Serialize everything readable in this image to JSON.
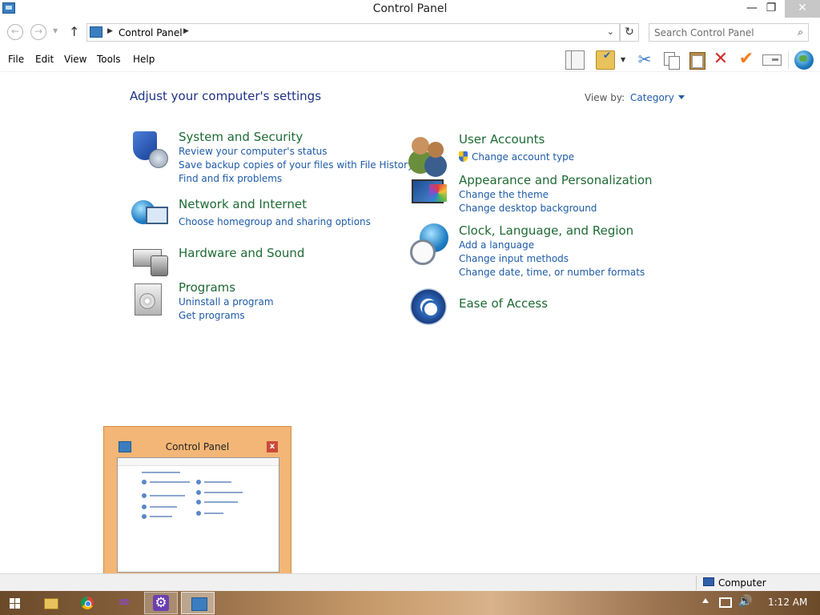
{
  "window": {
    "title": "Control Panel",
    "minimize": "—",
    "maximize": "❐",
    "close": "✕"
  },
  "address": {
    "breadcrumb": "Control Panel",
    "sep": "▶",
    "dropdown": "⌄",
    "refresh": "↻",
    "search_placeholder": "Search Control Panel",
    "search_icon": "⌕"
  },
  "nav": {
    "back": "←",
    "forward": "→",
    "recent": "▼",
    "up": "↑"
  },
  "menu": {
    "items": [
      "File",
      "Edit",
      "View",
      "Tools",
      "Help"
    ]
  },
  "toolbar": {
    "cut": "✂",
    "delete": "✕",
    "check": "✔",
    "drop": "▼"
  },
  "main": {
    "heading": "Adjust your computer's settings",
    "view_by_label": "View by:",
    "view_by_value": "Category",
    "categories_left": [
      {
        "title": "System and Security",
        "icon": "shield-icon",
        "links": [
          "Review your computer's status",
          "Save backup copies of your files with File History",
          "Find and fix problems"
        ]
      },
      {
        "title": "Network and Internet",
        "icon": "network-icon",
        "links": [
          "Choose homegroup and sharing options"
        ]
      },
      {
        "title": "Hardware and Sound",
        "icon": "printer-icon",
        "links": []
      },
      {
        "title": "Programs",
        "icon": "programs-icon",
        "links": [
          "Uninstall a program",
          "Get programs"
        ]
      }
    ],
    "categories_right": [
      {
        "title": "User Accounts",
        "icon": "users-icon",
        "links": [
          "Change account type"
        ]
      },
      {
        "title": "Appearance and Personalization",
        "icon": "appearance-icon",
        "links": [
          "Change the theme",
          "Change desktop background"
        ]
      },
      {
        "title": "Clock, Language, and Region",
        "icon": "clock-globe-icon",
        "links": [
          "Add a language",
          "Change input methods",
          "Change date, time, or number formats"
        ]
      },
      {
        "title": "Ease of Access",
        "icon": "ease-of-access-icon",
        "links": []
      }
    ]
  },
  "preview": {
    "title": "Control Panel",
    "close": "x"
  },
  "status": {
    "location": "Computer"
  },
  "taskbar": {
    "time": "1:12 AM",
    "vs_glyph": "∞",
    "volume_glyph": "🔊"
  }
}
